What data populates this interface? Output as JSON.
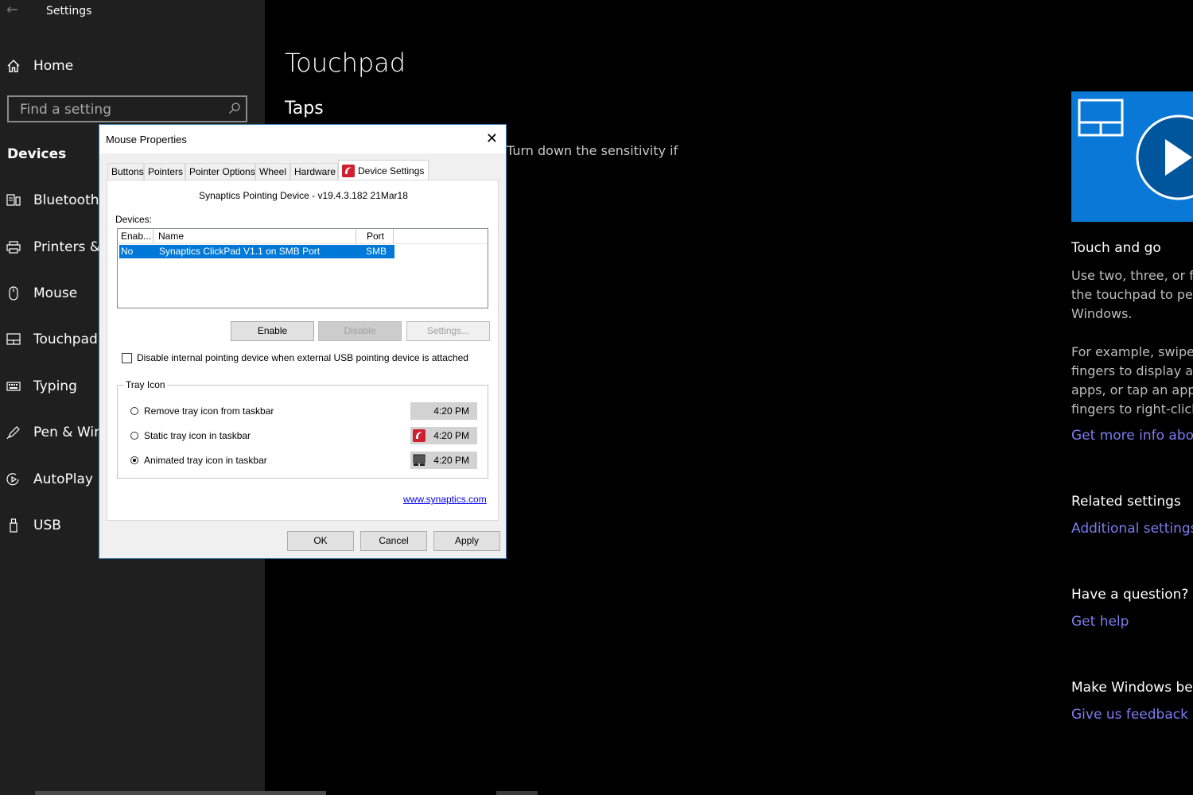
{
  "app": {
    "title": "Settings"
  },
  "sidebar": {
    "home": "Home",
    "search_placeholder": "Find a setting",
    "section": "Devices",
    "items": [
      {
        "label": "Bluetooth & other devices",
        "icon": "bluetooth-devices-icon"
      },
      {
        "label": "Printers & scanners",
        "icon": "printer-icon"
      },
      {
        "label": "Mouse",
        "icon": "mouse-icon"
      },
      {
        "label": "Touchpad",
        "icon": "touchpad-icon"
      },
      {
        "label": "Typing",
        "icon": "keyboard-icon"
      },
      {
        "label": "Pen & Windows Ink",
        "icon": "pen-icon"
      },
      {
        "label": "AutoPlay",
        "icon": "autoplay-icon"
      },
      {
        "label": "USB",
        "icon": "usb-icon"
      }
    ]
  },
  "main": {
    "title": "Touchpad",
    "section": "Taps",
    "peek_text": "Turn down the sensitivity if"
  },
  "right": {
    "video_title": "Touch and go",
    "p1": [
      "Use two, three, or four",
      "the touchpad to perfo",
      "Windows."
    ],
    "p2": [
      "For example, swipe up",
      "fingers to display all y",
      "apps, or tap an app or",
      "fingers to right-click."
    ],
    "more_link": "Get more info about T",
    "related_head": "Related settings",
    "related_link": "Additional settings",
    "question_head": "Have a question?",
    "help_link": "Get help",
    "better_head": "Make Windows better",
    "feedback_link": "Give us feedback"
  },
  "dialog": {
    "title": "Mouse Properties",
    "tabs": [
      "Buttons",
      "Pointers",
      "Pointer Options",
      "Wheel",
      "Hardware",
      "Device Settings"
    ],
    "device_title": "Synaptics Pointing Device - v19.4.3.182 21Mar18",
    "devices_label": "Devices:",
    "columns": [
      "Enab...",
      "Name",
      "Port"
    ],
    "rows": [
      {
        "enabled": "No",
        "name": "Synaptics ClickPad V1.1 on SMB Port",
        "port": "SMB"
      }
    ],
    "buttons": {
      "enable": "Enable",
      "disable": "Disable",
      "settings": "Settings..."
    },
    "checkbox_label": "Disable internal pointing device when external USB pointing device is attached",
    "tray_group": "Tray Icon",
    "radios": [
      {
        "label": "Remove tray icon from taskbar",
        "selected": false,
        "time": "4:20 PM"
      },
      {
        "label": "Static tray icon in taskbar",
        "selected": false,
        "time": "4:20 PM"
      },
      {
        "label": "Animated tray icon in taskbar",
        "selected": true,
        "time": "4:20 PM"
      }
    ],
    "link": "www.synaptics.com",
    "ok": "OK",
    "cancel": "Cancel",
    "apply": "Apply"
  },
  "colors": {
    "accent": "#0078d7",
    "link": "#7b7cf0",
    "sidebar_bg": "#1f1f1f",
    "synaptics_red": "#d01f2f"
  }
}
